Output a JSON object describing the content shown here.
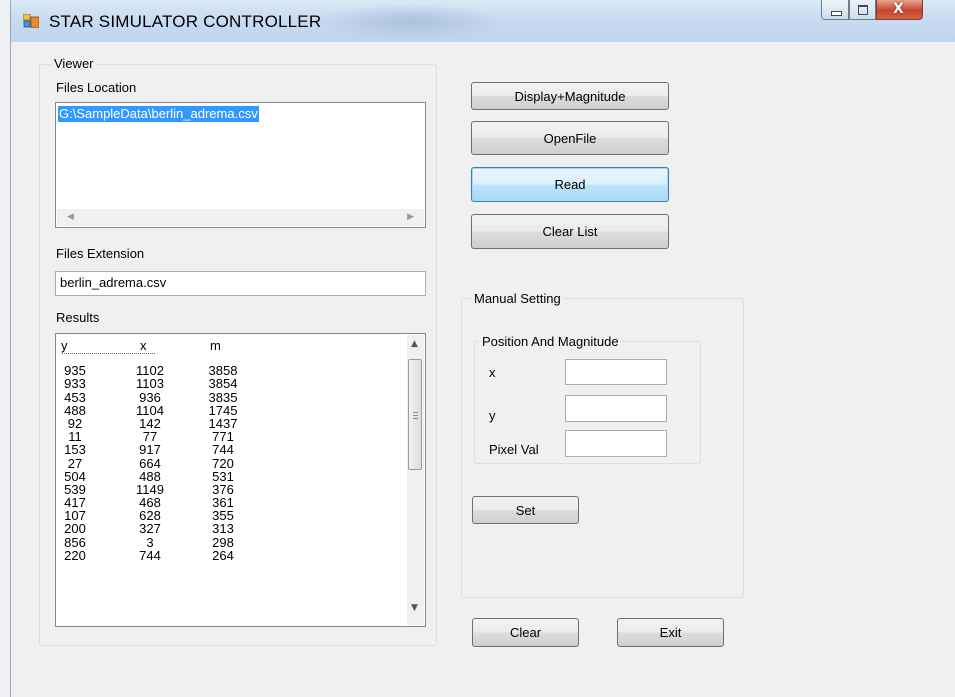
{
  "window": {
    "title": "STAR SIMULATOR CONTROLLER",
    "controls": {
      "minimize": "—",
      "maximize": "□",
      "close": "X"
    }
  },
  "viewer": {
    "group_label": "Viewer",
    "files_location_label": "Files Location",
    "files_location_items": [
      "G:\\SampleData\\berlin_adrema.csv"
    ],
    "files_extension_label": "Files Extension",
    "files_extension_value": "berlin_adrema.csv",
    "results_label": "Results",
    "results_headers": {
      "y": "y",
      "x": "x",
      "m": "m"
    },
    "results_rows": [
      [
        "935",
        "1102",
        "3858"
      ],
      [
        "933",
        "1103",
        "3854"
      ],
      [
        "453",
        "936",
        "3835"
      ],
      [
        "488",
        "1104",
        "1745"
      ],
      [
        "92",
        "142",
        "1437"
      ],
      [
        "11",
        "77",
        "771"
      ],
      [
        "153",
        "917",
        "744"
      ],
      [
        "27",
        "664",
        "720"
      ],
      [
        "504",
        "488",
        "531"
      ],
      [
        "539",
        "1149",
        "376"
      ],
      [
        "417",
        "468",
        "361"
      ],
      [
        "107",
        "628",
        "355"
      ],
      [
        "200",
        "327",
        "313"
      ],
      [
        "856",
        "3",
        "298"
      ],
      [
        "220",
        "744",
        "264"
      ]
    ]
  },
  "buttons": {
    "display_magnitude": "Display+Magnitude",
    "open_file": "OpenFile",
    "read": "Read",
    "clear_list": "Clear List",
    "set": "Set",
    "clear": "Clear",
    "exit": "Exit"
  },
  "manual_setting": {
    "group_label": "Manual Setting",
    "position_group_label": "Position And Magnitude",
    "x_label": "x",
    "y_label": "y",
    "pixel_val_label": "Pixel Val",
    "x_value": "",
    "y_value": "",
    "pixel_val_value": ""
  },
  "colors": {
    "selection": "#3399ff",
    "window_bg": "#f0f0f0",
    "close_button": "#c5442a"
  }
}
